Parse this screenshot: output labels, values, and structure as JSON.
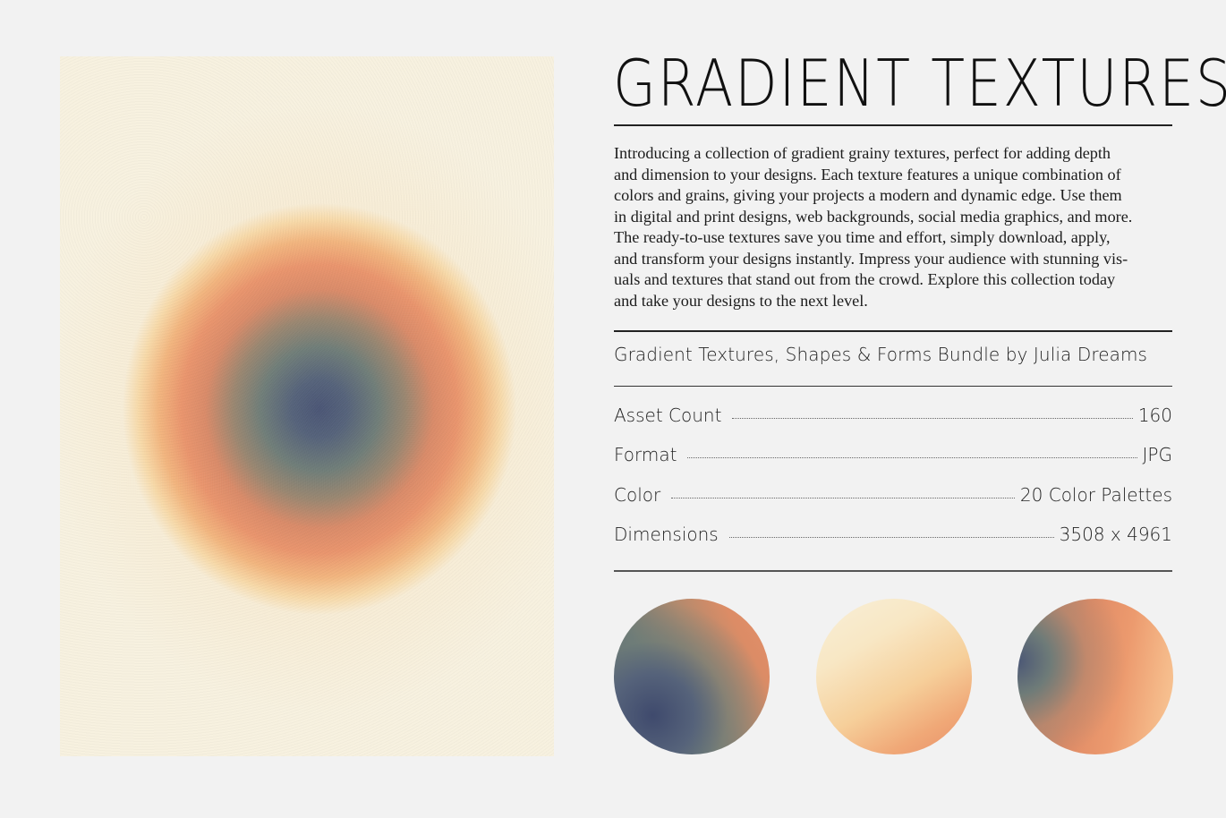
{
  "hero_image": {
    "label": "gradient texture preview",
    "colors": {
      "center": "#4a5575",
      "mid": "#e9946c",
      "outer": "#f7f1df"
    }
  },
  "title": "GRADIENT TEXTURES",
  "description": "Introducing a collection of gradient grainy textures, perfect for adding depth\nand dimension to your designs. Each texture features a unique combination of\ncolors and grains, giving your projects a modern and dynamic edge. Use them\nin digital and print designs, web backgrounds, social media graphics, and more.\nThe ready-to-use textures save you time and effort, simply download, apply,\nand transform your designs instantly. Impress your audience with stunning vis-\nuals and textures that stand out from the crowd. Explore this collection today\nand take your designs to the next level.",
  "subtitle": "Gradient Textures, Shapes & Forms Bundle by Julia Dreams",
  "specs": [
    {
      "label": "Asset Count",
      "value": "160"
    },
    {
      "label": "Format",
      "value": "JPG"
    },
    {
      "label": "Color",
      "value": "20 Color Palettes"
    },
    {
      "label": "Dimensions",
      "value": "3508 x 4961"
    }
  ],
  "swatches": [
    {
      "name": "navy-orange",
      "colors": [
        "#3f4a6d",
        "#e3906a"
      ]
    },
    {
      "name": "cream-peach",
      "colors": [
        "#f8efd8",
        "#e88f68"
      ]
    },
    {
      "name": "slate-orange-peach",
      "colors": [
        "#4c5876",
        "#e08b66",
        "#f8c998"
      ]
    }
  ]
}
